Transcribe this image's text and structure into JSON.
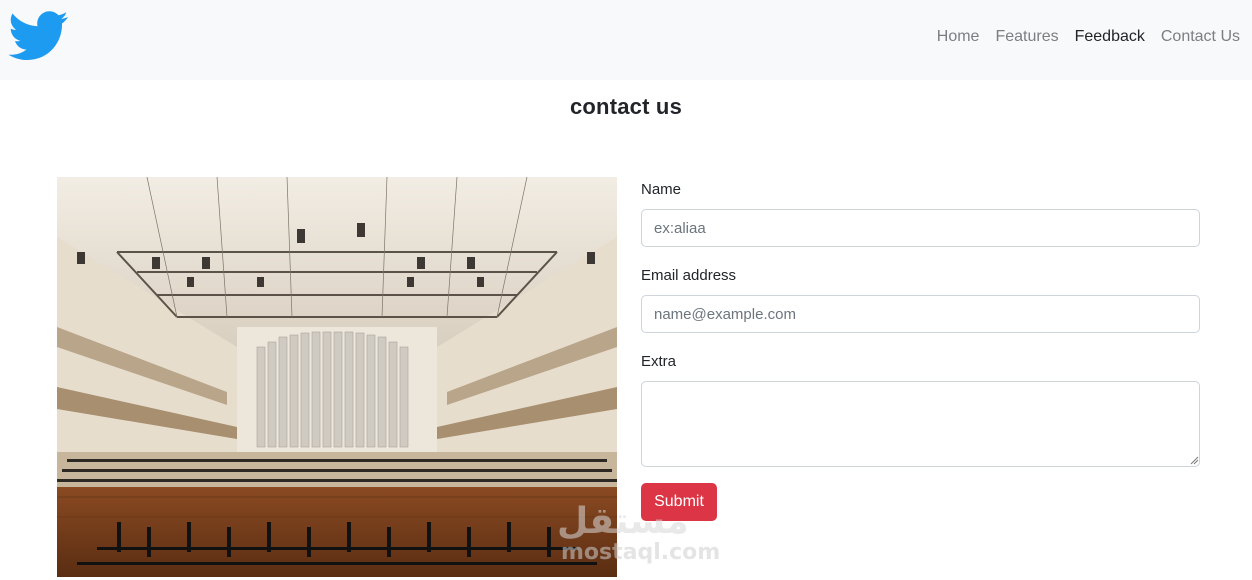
{
  "navbar": {
    "logo_icon": "twitter-bird-icon",
    "brand_color": "#1d9bf0",
    "items": [
      {
        "label": "Home",
        "active": false
      },
      {
        "label": "Features",
        "active": false
      },
      {
        "label": "Feedback",
        "active": true
      },
      {
        "label": "Contact Us",
        "active": false
      }
    ]
  },
  "page": {
    "title": "contact us"
  },
  "image": {
    "description": "concert hall"
  },
  "form": {
    "name_label": "Name",
    "name_placeholder": "ex:aliaa",
    "name_value": "",
    "email_label": "Email address",
    "email_placeholder": "name@example.com",
    "email_value": "",
    "extra_label": "Extra",
    "extra_value": "",
    "submit_label": "Submit",
    "submit_color": "#dc3545"
  },
  "watermark": {
    "script": "مستقل",
    "text": "mostaql.com"
  }
}
